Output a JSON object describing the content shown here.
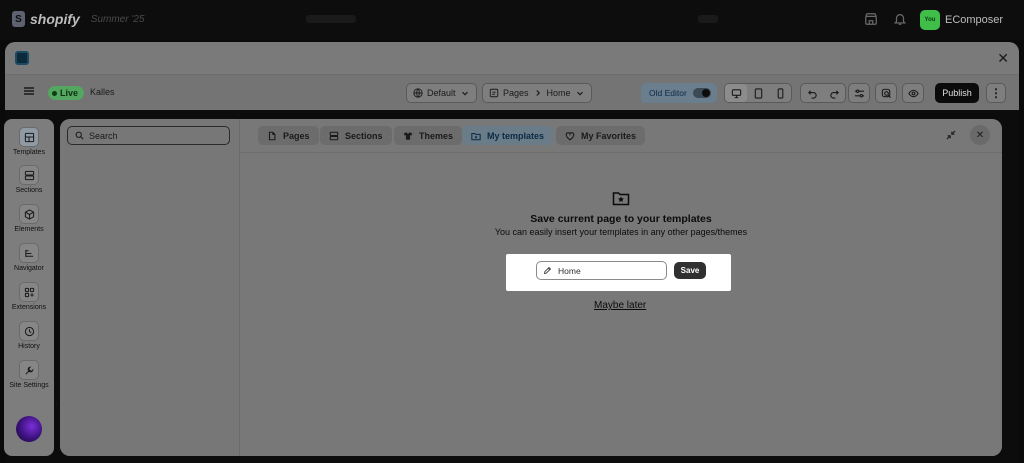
{
  "shopify": {
    "brand": "shopify",
    "edition": "Summer '25",
    "store_avatar": "You",
    "store_name": "EComposer",
    "icons": [
      "store-icon",
      "bell-icon"
    ]
  },
  "app": {
    "logo": "ecomposer-logo",
    "close": "✕"
  },
  "toolbar": {
    "status": "Live",
    "store_name": "Kalles",
    "theme_dropdown": "Default",
    "pages_label": "Pages",
    "page_label": "Home",
    "old_editor_label": "Old Editor",
    "publish_label": "Publish",
    "more_label": "⋮"
  },
  "sidebar": {
    "items": [
      {
        "label": "Templates",
        "icon": "templates-icon"
      },
      {
        "label": "Sections",
        "icon": "sections-icon"
      },
      {
        "label": "Elements",
        "icon": "elements-icon"
      },
      {
        "label": "Navigator",
        "icon": "navigator-icon"
      },
      {
        "label": "Extensions",
        "icon": "extensions-icon"
      },
      {
        "label": "History",
        "icon": "history-icon"
      },
      {
        "label": "Site Settings",
        "icon": "settings-icon"
      }
    ]
  },
  "panel": {
    "search_placeholder": "Search",
    "tabs": [
      {
        "label": "Pages"
      },
      {
        "label": "Sections"
      },
      {
        "label": "Themes"
      },
      {
        "label": "My templates"
      },
      {
        "label": "My Favorites"
      }
    ],
    "active_tab": "My templates",
    "save_title": "Save current page to your templates",
    "save_subtitle": "You can easily insert your templates in any other pages/themes",
    "template_name_value": "Home",
    "save_button": "Save",
    "maybe_later": "Maybe later"
  },
  "colors": {
    "live_badge": "#53a760",
    "active_tab": "#6a7c88",
    "publish": "#0b0b0b",
    "save_button": "#303030"
  }
}
